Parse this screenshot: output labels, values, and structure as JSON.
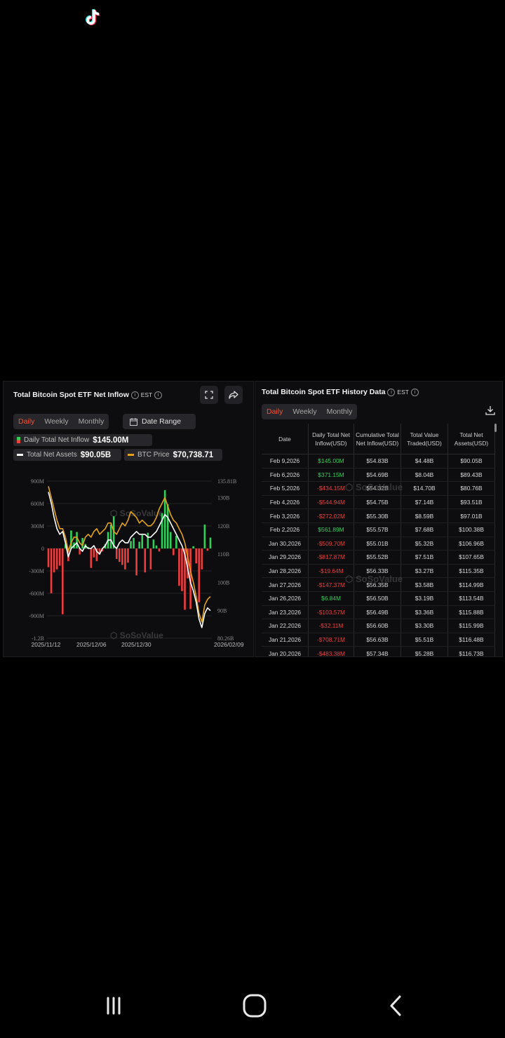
{
  "status": {
    "app_icon": "tiktok-icon"
  },
  "left_panel": {
    "title": "Total Bitcoin Spot ETF Net Inflow",
    "tz": "EST",
    "tabs": [
      "Daily",
      "Weekly",
      "Monthly"
    ],
    "active_tab": "Daily",
    "date_range_label": "Date Range",
    "legend": {
      "inflow_label": "Daily Total Net Inflow",
      "inflow_value": "$145.00M",
      "assets_label": "Total Net Assets",
      "assets_value": "$90.05B",
      "price_label": "BTC Price",
      "price_value": "$70,738.71"
    },
    "watermark": "SoSoValue",
    "colors": {
      "positive": "#2fcf58",
      "negative": "#ee3d3d",
      "assets_line": "#ffffff",
      "price_line": "#e3a21a",
      "accent": "#e8573a"
    }
  },
  "chart_data": {
    "type": "bar",
    "x_ticks": [
      "2025/11/12",
      "2025/12/06",
      "2025/12/30",
      "2026/02/09"
    ],
    "y_left_ticks": [
      "900M",
      "600M",
      "300M",
      "0",
      "-300M",
      "-600M",
      "-900M",
      "-1.2B"
    ],
    "y_left_range": [
      -1200,
      900
    ],
    "y_right_ticks": [
      "135.81B",
      "130B",
      "120B",
      "110B",
      "100B",
      "90B",
      "80.26B"
    ],
    "y_right_range": [
      80.26,
      135.81
    ],
    "series": [
      {
        "name": "Daily Total Net Inflow",
        "unit": "M",
        "values": [
          -250,
          -600,
          -320,
          -280,
          -230,
          -880,
          60,
          -170,
          240,
          80,
          220,
          -80,
          140,
          60,
          20,
          -260,
          -120,
          -170,
          -80,
          -40,
          60,
          220,
          320,
          430,
          -140,
          -180,
          -220,
          -280,
          -190,
          100,
          140,
          -360,
          90,
          180,
          -320,
          210,
          -280,
          120,
          40,
          -40,
          470,
          780,
          590,
          220,
          -90,
          170,
          -500,
          -570,
          -820,
          -400,
          -810,
          30,
          -200,
          -720,
          -280,
          320,
          -30,
          145
        ]
      },
      {
        "name": "Total Net Assets",
        "unit": "B",
        "values": [
          132,
          128,
          123,
          119,
          117,
          118,
          114,
          109,
          112,
          113,
          114,
          112,
          111,
          113,
          112,
          112,
          113,
          111,
          110,
          112,
          113,
          115,
          115,
          113,
          112,
          114,
          115,
          114,
          114,
          116,
          117,
          118,
          117,
          117,
          117,
          116,
          116,
          117,
          118,
          120,
          122,
          124,
          123,
          121,
          119,
          117,
          115,
          113,
          110,
          105,
          100,
          97,
          93,
          87,
          84,
          89,
          91,
          90
        ]
      },
      {
        "name": "BTC Price",
        "unit": "B-axis",
        "values": [
          134,
          130,
          126,
          122,
          119,
          119,
          116,
          111,
          114,
          116,
          116,
          114,
          113,
          116,
          117,
          116,
          118,
          119,
          117,
          118,
          119,
          121,
          121,
          118,
          117,
          119,
          121,
          120,
          122,
          125,
          124,
          123,
          121,
          122,
          121,
          120,
          120,
          121,
          123,
          126,
          128,
          130,
          127,
          124,
          122,
          121,
          119,
          117,
          114,
          109,
          104,
          100,
          95,
          89,
          86,
          92,
          94,
          95
        ]
      }
    ]
  },
  "right_panel": {
    "title": "Total Bitcoin Spot ETF History Data",
    "tz": "EST",
    "tabs": [
      "Daily",
      "Weekly",
      "Monthly"
    ],
    "active_tab": "Daily",
    "columns": [
      "Date",
      "Daily Total Net Inflow(USD)",
      "Cumulative Total Net Inflow(USD)",
      "Total Value Traded(USD)",
      "Total Net Assets(USD)"
    ],
    "rows": [
      [
        "Feb 9,2026",
        "$145.00M",
        "$54.83B",
        "$4.48B",
        "$90.05B"
      ],
      [
        "Feb 6,2026",
        "$371.15M",
        "$54.69B",
        "$8.04B",
        "$89.43B"
      ],
      [
        "Feb 5,2026",
        "-$434.15M",
        "$54.32B",
        "$14.70B",
        "$80.76B"
      ],
      [
        "Feb 4,2026",
        "-$544.94M",
        "$54.75B",
        "$7.14B",
        "$93.51B"
      ],
      [
        "Feb 3,2026",
        "-$272.02M",
        "$55.30B",
        "$8.59B",
        "$97.01B"
      ],
      [
        "Feb 2,2026",
        "$561.89M",
        "$55.57B",
        "$7.68B",
        "$100.38B"
      ],
      [
        "Jan 30,2026",
        "-$509.70M",
        "$55.01B",
        "$5.32B",
        "$106.96B"
      ],
      [
        "Jan 29,2026",
        "-$817.87M",
        "$55.52B",
        "$7.51B",
        "$107.65B"
      ],
      [
        "Jan 28,2026",
        "-$19.64M",
        "$56.33B",
        "$3.27B",
        "$115.35B"
      ],
      [
        "Jan 27,2026",
        "-$147.37M",
        "$56.35B",
        "$3.58B",
        "$114.99B"
      ],
      [
        "Jan 26,2026",
        "$6.84M",
        "$56.50B",
        "$3.19B",
        "$113.54B"
      ],
      [
        "Jan 23,2026",
        "-$103.57M",
        "$56.49B",
        "$3.36B",
        "$115.88B"
      ],
      [
        "Jan 22,2026",
        "-$32.11M",
        "$56.60B",
        "$3.30B",
        "$115.99B"
      ],
      [
        "Jan 21,2026",
        "-$708.71M",
        "$56.63B",
        "$5.51B",
        "$116.48B"
      ],
      [
        "Jan 20,2026",
        "-$483.38M",
        "$57.34B",
        "$5.28B",
        "$116.73B"
      ]
    ]
  },
  "navbar": {
    "recent_icon": "recent-apps-icon",
    "home_icon": "home-icon",
    "back_icon": "back-icon"
  }
}
